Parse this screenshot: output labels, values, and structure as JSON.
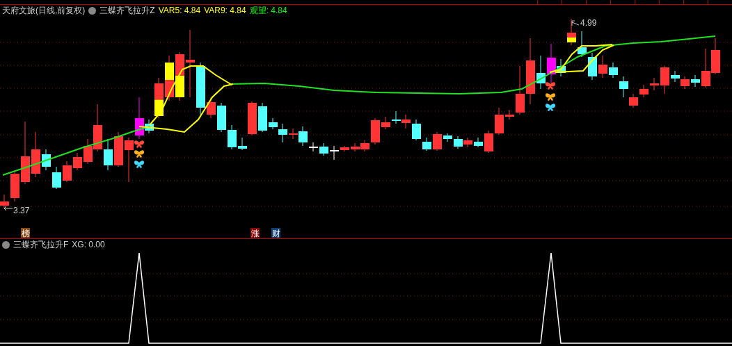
{
  "stock_header": {
    "title": "天府文旅(日线,前复权)",
    "indicator": "三蝶齐飞拉升Z",
    "values": [
      {
        "label": "VAR5:",
        "value": "4.84",
        "color": "#ffff00"
      },
      {
        "label": "VAR9:",
        "value": "4.84",
        "color": "#ffff00"
      },
      {
        "label": "观望:",
        "value": "4.84",
        "color": "#00ff00"
      }
    ]
  },
  "price_chart": {
    "high_label": "4.99",
    "low_label": "3.37"
  },
  "event_badges": [
    {
      "text": "榜",
      "color": "#8b4a14"
    },
    {
      "text": "涨",
      "color": "#8b0a0a"
    },
    {
      "text": "财",
      "color": "#123f78"
    }
  ],
  "lower_pane": {
    "indicator": "三蝶齐飞拉升F",
    "reading": "XG: 0.00"
  }
}
